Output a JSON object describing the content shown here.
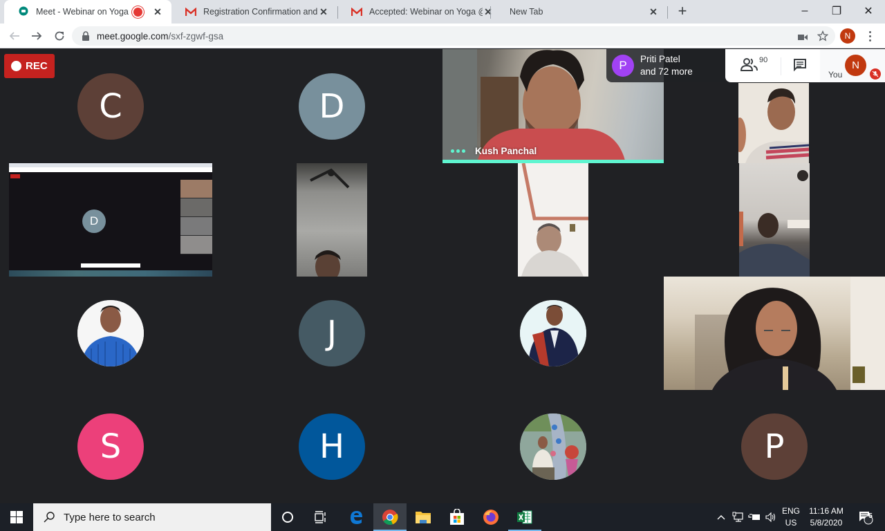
{
  "browser": {
    "tabs": [
      {
        "title": "Meet - Webinar on Yoga",
        "icon": "google-meet-icon",
        "recording": true,
        "active": true
      },
      {
        "title": "Registration Confirmation and Re",
        "icon": "gmail-icon",
        "active": false
      },
      {
        "title": "Accepted: Webinar on Yoga @ Fr",
        "icon": "gmail-icon",
        "active": false
      },
      {
        "title": "New Tab",
        "icon": null,
        "active": false
      }
    ],
    "new_tab_label": "+",
    "window_controls": {
      "minimize": "–",
      "restore": "❐",
      "close": "✕"
    },
    "url_host": "meet.google.com",
    "url_path": "/sxf-zgwf-gsa",
    "profile_initial": "N"
  },
  "meet": {
    "rec_label": "REC",
    "presenter": {
      "initial": "P",
      "name": "Priti Patel",
      "more": "and 72 more",
      "color": "#a142f4"
    },
    "participant_count": "90",
    "you_label": "You",
    "you_initial": "N",
    "active_speaker": "Kush Panchal",
    "tiles": [
      {
        "type": "initial",
        "initial": "C",
        "color": "#5d4037"
      },
      {
        "type": "initial",
        "initial": "D",
        "color": "#78909c"
      },
      {
        "type": "video",
        "name": "Kush Panchal",
        "speaking": true
      },
      {
        "type": "video",
        "name": ""
      },
      {
        "type": "screen-share",
        "inner_initial": "D"
      },
      {
        "type": "video",
        "name": ""
      },
      {
        "type": "video",
        "name": ""
      },
      {
        "type": "video",
        "name": ""
      },
      {
        "type": "photo",
        "name": ""
      },
      {
        "type": "initial",
        "initial": "J",
        "color": "#455a64"
      },
      {
        "type": "photo",
        "name": ""
      },
      {
        "type": "video",
        "name": ""
      },
      {
        "type": "initial",
        "initial": "S",
        "color": "#ec407a"
      },
      {
        "type": "initial",
        "initial": "H",
        "color": "#01579b"
      },
      {
        "type": "photo",
        "name": ""
      },
      {
        "type": "initial",
        "initial": "P",
        "color": "#5d4037"
      }
    ]
  },
  "taskbar": {
    "search_placeholder": "Type here to search",
    "apps": [
      "cortana",
      "task-view",
      "edge",
      "chrome",
      "file-explorer",
      "store",
      "firefox",
      "excel"
    ],
    "lang_top": "ENG",
    "lang_bottom": "US",
    "time": "11:16 AM",
    "date": "5/8/2020",
    "notification_count": "5"
  }
}
